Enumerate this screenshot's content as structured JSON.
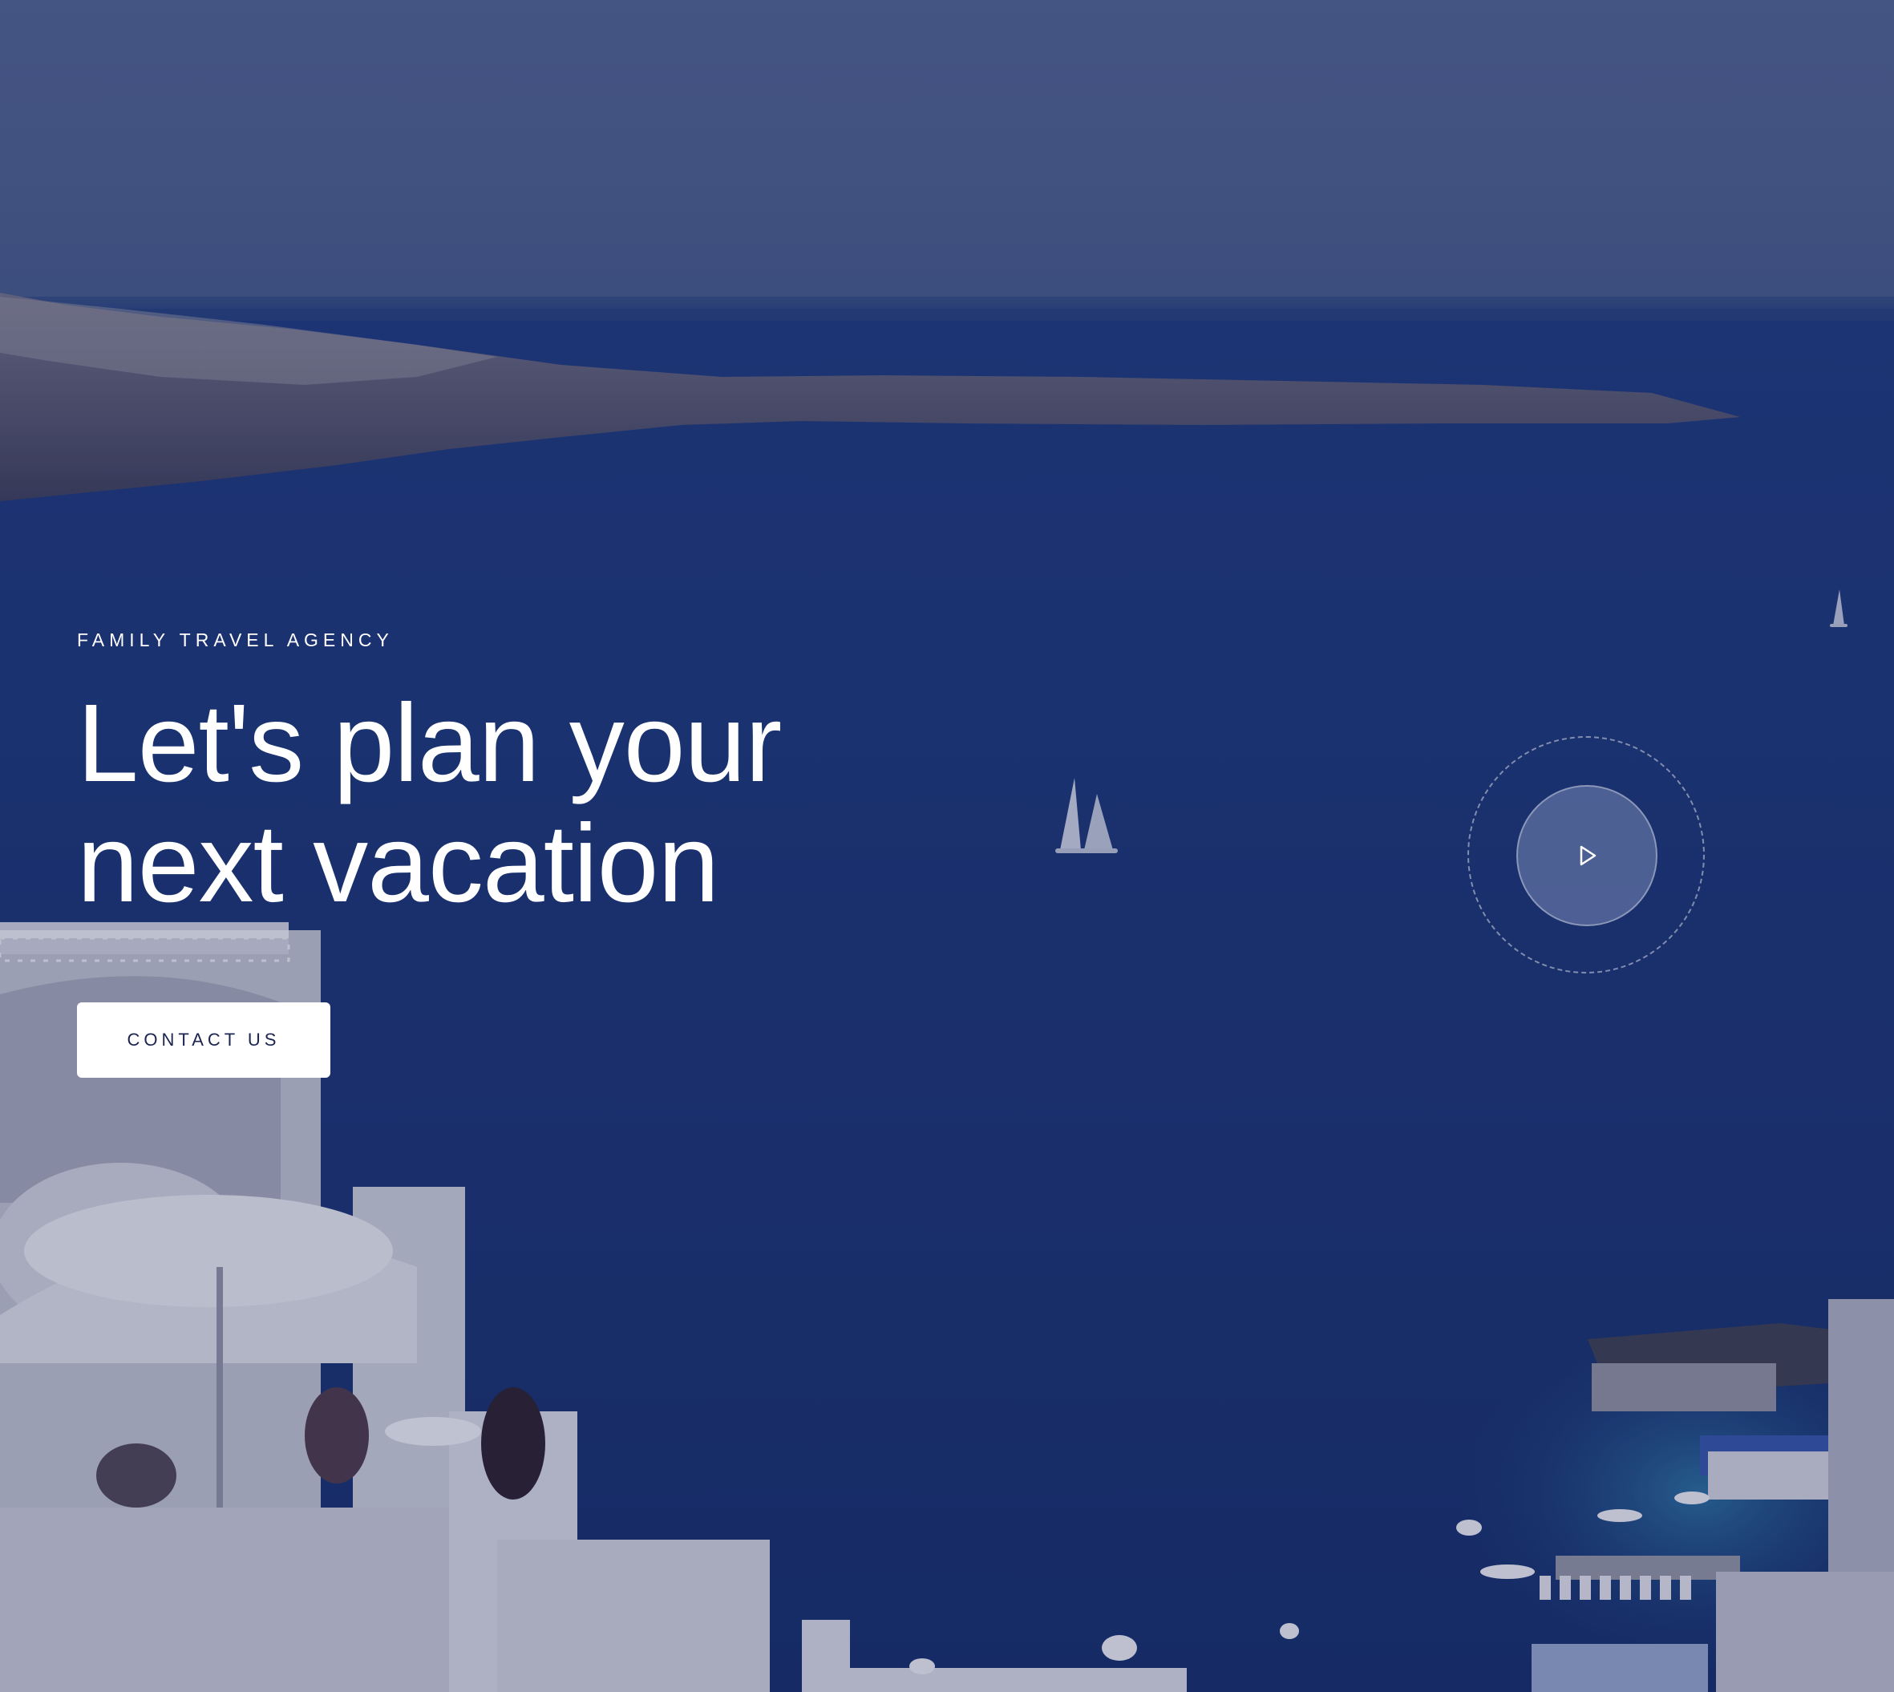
{
  "hero": {
    "eyebrow": "FAMILY TRAVEL AGENCY",
    "headline_line1": "Let's plan your",
    "headline_line2": "next vacation",
    "cta_label": "CONTACT US",
    "play_icon": "play-icon"
  },
  "colors": {
    "overlay_tint": "#1b2f73",
    "text": "#ffffff",
    "button_bg": "#ffffff",
    "button_text": "#1b2550"
  }
}
